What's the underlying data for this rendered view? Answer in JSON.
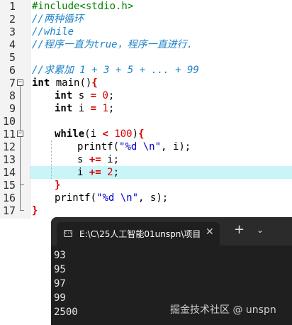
{
  "editor": {
    "line_numbers": [
      "1",
      "2",
      "3",
      "4",
      "5",
      "6",
      "7",
      "8",
      "9",
      "10",
      "11",
      "12",
      "13",
      "14",
      "15",
      "16",
      "17"
    ],
    "lines": {
      "l1": "#include<stdio.h>",
      "l2": "//两种循环",
      "l3": "//while",
      "l4": "//程序一直为true，程序一直进行.",
      "l6": "//求累加 1 + 3 + 5 + ... + 99",
      "l7_kw": "int",
      "l7_rest": " main()",
      "l7_brace": "{",
      "l8_kw": "int",
      "l8_a": " s ",
      "l8_op": "=",
      "l8_sp": " ",
      "l8_num": "0",
      "l8_end": ";",
      "l9_kw": "int",
      "l9_a": " i ",
      "l9_op": "=",
      "l9_sp": " ",
      "l9_num": "1",
      "l9_end": ";",
      "l11_kw": "while",
      "l11_a": "(i ",
      "l11_op": "<",
      "l11_sp": " ",
      "l11_num": "100",
      "l11_b": ")",
      "l11_brace": "{",
      "l12_a": "printf(",
      "l12_str": "\"%d \\n\"",
      "l12_b": ", i);",
      "l13_a": "s ",
      "l13_op": "+=",
      "l13_b": " i;",
      "l14_a": "i ",
      "l14_op": "+=",
      "l14_sp": " ",
      "l14_num": "2",
      "l14_end": ";",
      "l15_brace": "}",
      "l16_a": "printf(",
      "l16_str": "\"%d \\n\"",
      "l16_b": ", s);",
      "l17_brace": "}"
    },
    "highlighted_line": 14
  },
  "terminal": {
    "tab_title": "E:\\C\\25人工智能01unspn\\项目",
    "tab_close": "✕",
    "new_tab": "+",
    "menu": "⌄",
    "output": [
      "93",
      "95",
      "97",
      "99",
      "2500"
    ]
  },
  "watermark": "掘金技术社区 @ unspn",
  "colors": {
    "comment": "#1f83c8",
    "preprocessor": "#008000",
    "operator": "#d40000",
    "string": "#0000cc",
    "highlight": "#c9f4f8",
    "terminal_bg": "#1f1f1f"
  }
}
